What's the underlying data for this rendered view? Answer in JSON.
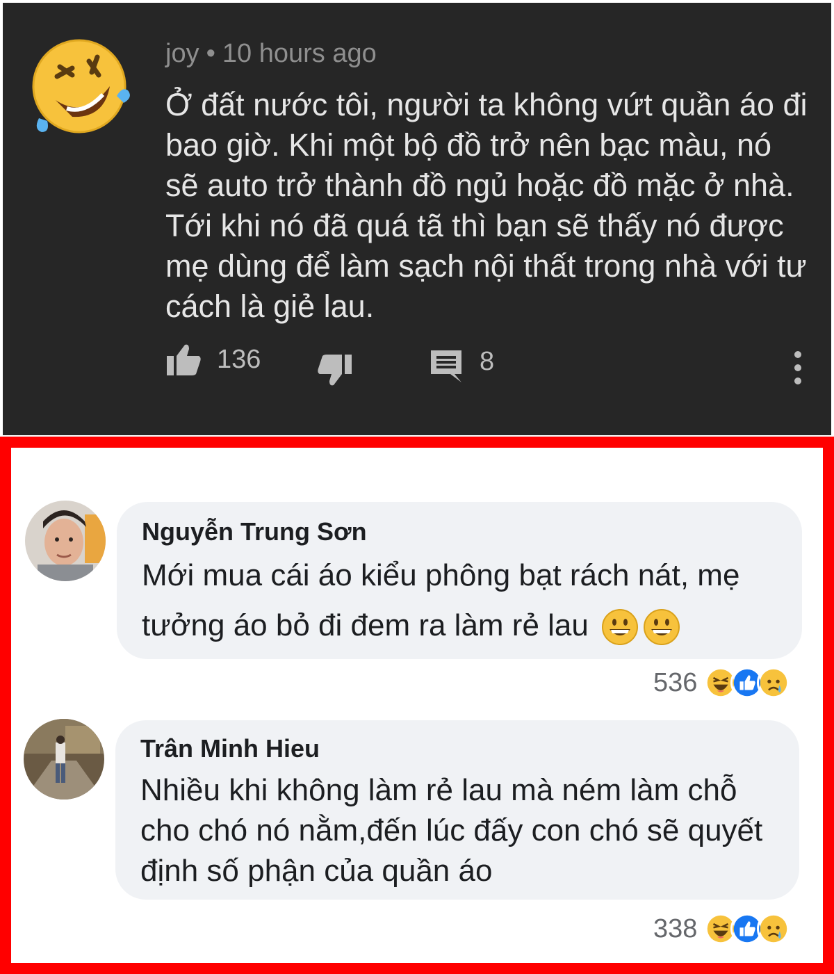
{
  "youtube_comment": {
    "author": "joy",
    "separator": "•",
    "time": "10 hours ago",
    "text": "Ở đất nước tôi, người ta không vứt quần áo đi bao giờ. Khi một bộ đồ trở nên bạc màu, nó sẽ auto trở thành đồ ngủ hoặc đồ mặc ở nhà. Tới khi nó đã quá tã thì bạn sẽ thấy nó được mẹ dùng để làm sạch nội thất trong nhà với tư cách là giẻ lau.",
    "likes": "136",
    "replies": "8"
  },
  "facebook_comments": [
    {
      "name": "Nguyễn Trung Sơn",
      "text": "Mới mua cái áo kiểu phông bạt rách nát, mẹ tưởng áo bỏ đi đem ra làm rẻ lau",
      "reaction_count": "536"
    },
    {
      "name": "Trân Minh Hieu",
      "text": "Nhiều khi không làm rẻ lau mà ném làm chỗ cho chó nó nằm,đến lúc đấy con chó sẽ quyết định số phận của quần áo",
      "reaction_count": "338"
    }
  ],
  "colors": {
    "dark_bg": "#262626",
    "frame_red": "#ff0000",
    "bubble_bg": "#f0f2f5",
    "like_blue": "#1877f2",
    "haha_yellow": "#f7c23c"
  }
}
